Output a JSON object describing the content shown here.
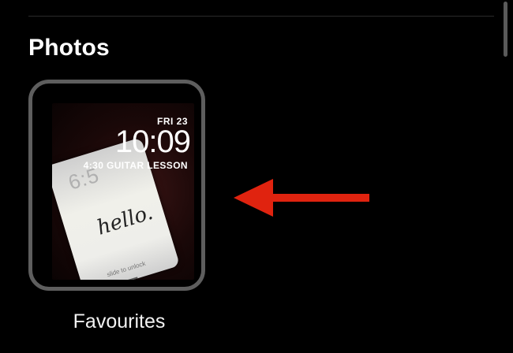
{
  "section": {
    "title": "Photos"
  },
  "watch_face": {
    "label": "Favourites",
    "date": "FRI 23",
    "time": "10:09",
    "event": "4:30 GUITAR LESSON",
    "photo": {
      "phone_time": "6:5",
      "phone_text": "hello.",
      "phone_unlock": "slide to unlock"
    }
  },
  "annotation": {
    "arrow_color": "#e0230f",
    "direction": "left"
  },
  "colors": {
    "background": "#000000",
    "card_border": "#5e5e5e",
    "text": "#ffffff"
  }
}
